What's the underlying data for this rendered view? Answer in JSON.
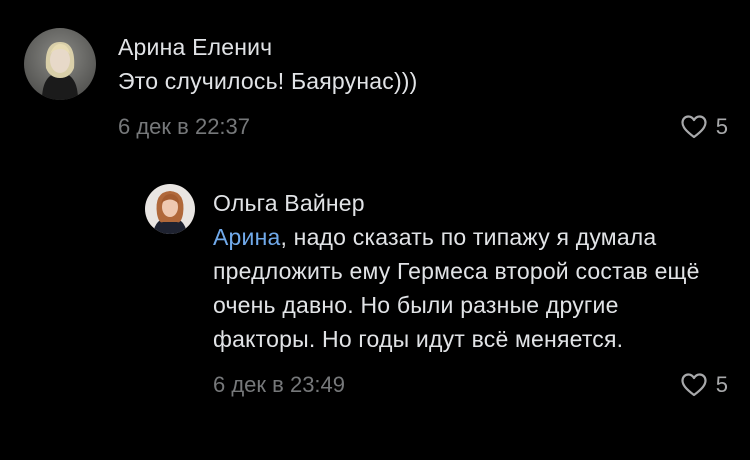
{
  "comments": [
    {
      "author": "Арина Еленич",
      "text": "Это случилось! Баярунас)))",
      "time": "6 дек в 22:37",
      "likes": "5"
    }
  ],
  "reply": {
    "author": "Ольга Вайнер",
    "mention": "Арина",
    "text": ", надо сказать по типажу я думала предложить ему Гермеса второй состав ещё очень давно. Но были разные другие факторы. Но годы идут всё меняется.",
    "time": "6 дек в 23:49",
    "likes": "5"
  },
  "colors": {
    "background": "#000000",
    "text": "#e1e3e6",
    "mention": "#71aaeb",
    "meta": "#76787a"
  },
  "icons": {
    "like": "heart-outline-icon"
  }
}
